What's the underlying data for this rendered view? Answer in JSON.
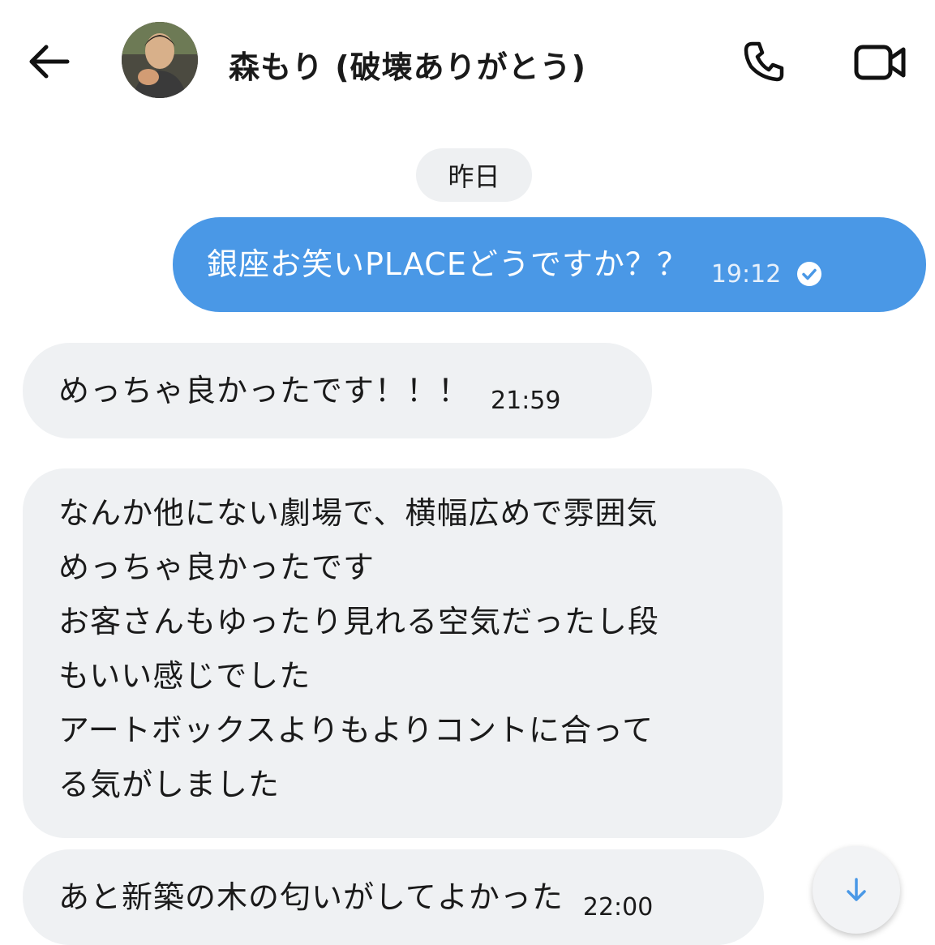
{
  "header": {
    "contact_name": "森もり (破壊ありがとう)",
    "back_icon": "arrow-left-icon",
    "call_icon": "phone-icon",
    "video_icon": "video-camera-icon"
  },
  "date_divider": "昨日",
  "messages": [
    {
      "direction": "outgoing",
      "text": "銀座お笑いPLACEどうですか？？",
      "time": "19:12",
      "status_icon": "read-check-icon"
    },
    {
      "direction": "incoming",
      "text": "めっちゃ良かったです！！！",
      "time": "21:59"
    },
    {
      "direction": "incoming",
      "lines": [
        "なんか他にない劇場で、横幅広めで雰囲気",
        "めっちゃ良かったです",
        "お客さんもゆったり見れる空気だったし段",
        "もいい感じでした",
        "アートボックスよりもよりコントに合って",
        "る気がしました"
      ]
    },
    {
      "direction": "incoming",
      "text": "あと新築の木の匂いがしてよかった",
      "time": "22:00"
    }
  ],
  "scroll_button_icon": "arrow-down-icon",
  "colors": {
    "outgoing_bubble": "#4a98e6",
    "incoming_bubble": "#eff1f3",
    "accent": "#4a98e6"
  }
}
